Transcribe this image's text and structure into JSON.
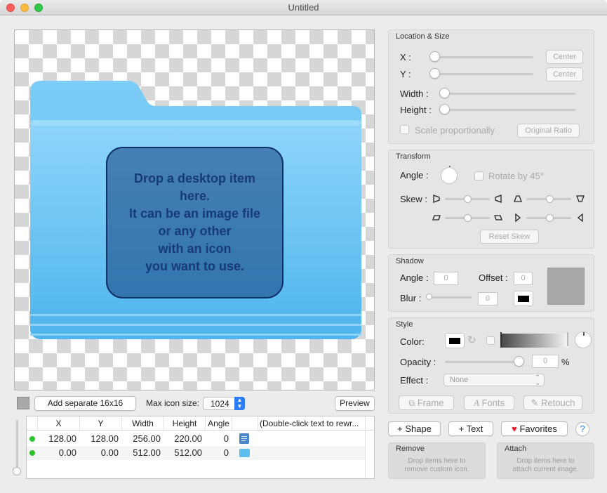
{
  "window": {
    "title": "Untitled"
  },
  "canvas": {
    "drop_hint": "Drop a desktop item\nhere.\nIt can be an image file\nor any other\nwith an icon\nyou want to use."
  },
  "bottom_bar": {
    "add_separate": "Add separate 16x16",
    "max_icon_size_label": "Max icon size:",
    "max_icon_size_value": "1024",
    "preview": "Preview"
  },
  "layers_table": {
    "headers": [
      "X",
      "Y",
      "Width",
      "Height",
      "Angle",
      "",
      "(Double-click text to rewr..."
    ],
    "rows": [
      {
        "x": "128.00",
        "y": "128.00",
        "width": "256.00",
        "height": "220.00",
        "angle": "0",
        "icon": "text-document-icon",
        "status": "green"
      },
      {
        "x": "0.00",
        "y": "0.00",
        "width": "512.00",
        "height": "512.00",
        "angle": "0",
        "icon": "folder-icon",
        "status": "green"
      }
    ]
  },
  "location_size": {
    "title": "Location & Size",
    "x_label": "X :",
    "y_label": "Y :",
    "width_label": "Width :",
    "height_label": "Height :",
    "center": "Center",
    "scale_proportionally": "Scale proportionally",
    "original_ratio": "Original Ratio"
  },
  "transform": {
    "title": "Transform",
    "angle_label": "Angle :",
    "rotate45": "Rotate by 45°",
    "skew_label": "Skew :",
    "reset_skew": "Reset Skew"
  },
  "shadow": {
    "title": "Shadow",
    "angle_label": "Angle :",
    "angle_value": "0",
    "offset_label": "Offset :",
    "offset_value": "0",
    "blur_label": "Blur :",
    "blur_value": "0"
  },
  "style": {
    "title": "Style",
    "color_label": "Color:",
    "opacity_label": "Opacity :",
    "opacity_value": "0",
    "percent": "%",
    "effect_label": "Effect :",
    "effect_value": "None",
    "frame": "Frame",
    "fonts": "Fonts",
    "retouch": "Retouch"
  },
  "actions": {
    "shape": "Shape",
    "text": "Text",
    "favorites": "Favorites",
    "help": "?"
  },
  "remove": {
    "title": "Remove",
    "hint": "Drop items here to\nremove custom icon."
  },
  "attach": {
    "title": "Attach",
    "hint": "Drop items here to\nattach current image."
  },
  "colors": {
    "folder": "#5ebef0",
    "drop_box_border": "#0f2f68",
    "status_green": "#2cc52c",
    "accent": "#2f7df6"
  }
}
